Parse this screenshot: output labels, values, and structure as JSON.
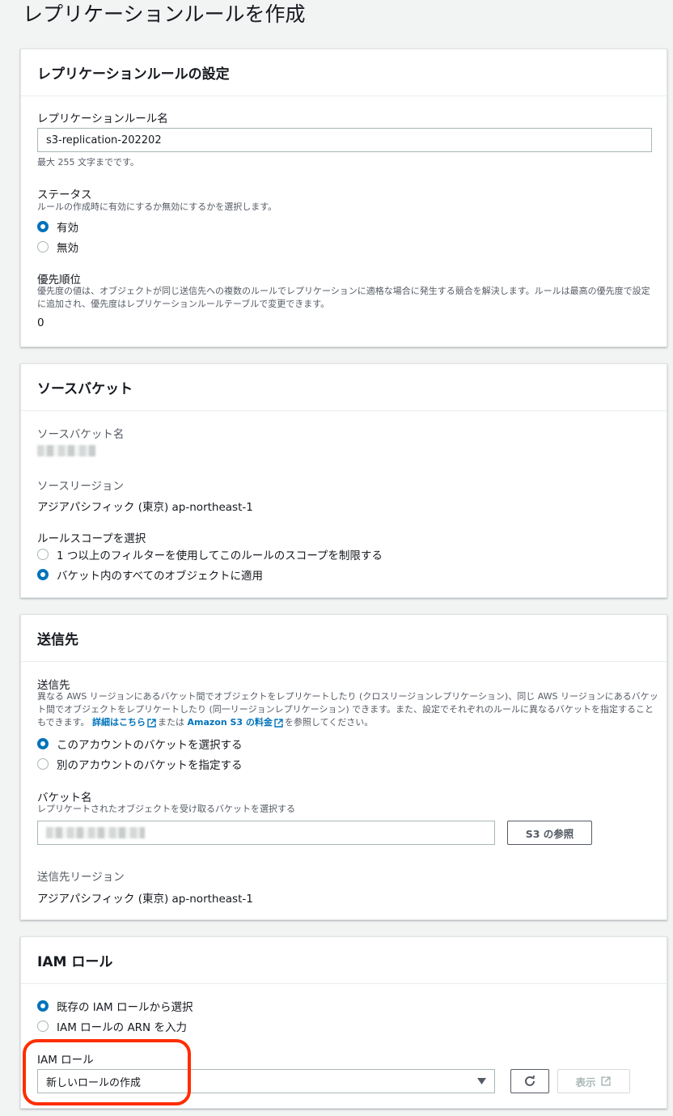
{
  "page": {
    "title": "レプリケーションルールを作成"
  },
  "rule_settings": {
    "header": "レプリケーションルールの設定",
    "name_label": "レプリケーションルール名",
    "name_value": "s3-replication-202202",
    "name_hint": "最大 255 文字までです。",
    "status_label": "ステータス",
    "status_desc": "ルールの作成時に有効にするか無効にするかを選択します。",
    "status_options": [
      "有効",
      "無効"
    ],
    "priority_label": "優先順位",
    "priority_desc": "優先度の値は、オブジェクトが同じ送信先への複数のルールでレプリケーションに適格な場合に発生する競合を解決します。ルールは最高の優先度で設定に追加され、優先度はレプリケーションルールテーブルで変更できます。",
    "priority_value": "0"
  },
  "source_bucket": {
    "header": "ソースバケット",
    "name_label": "ソースバケット名",
    "region_label": "ソースリージョン",
    "region_value": "アジアパシフィック (東京) ap-northeast-1",
    "scope_label": "ルールスコープを選択",
    "scope_options": [
      "1 つ以上のフィルターを使用してこのルールのスコープを制限する",
      "バケット内のすべてのオブジェクトに適用"
    ]
  },
  "destination": {
    "header": "送信先",
    "label": "送信先",
    "desc_part1": "異なる AWS リージョンにあるバケット間でオブジェクトをレプリケートしたり (クロスリージョンレプリケーション)、同じ AWS リージョンにあるバケット間でオブジェクトをレプリケートしたり (同一リージョンレプリケーション) できます。また、設定でそれぞれのルールに異なるバケットを指定することもできます。",
    "link1": "詳細はこちら",
    "desc_part2": "または",
    "link2": "Amazon S3 の料金",
    "desc_part3": "を参照してください。",
    "options": [
      "このアカウントのバケットを選択する",
      "別のアカウントのバケットを指定する"
    ],
    "bucket_label": "バケット名",
    "bucket_desc": "レプリケートされたオブジェクトを受け取るバケットを選択する",
    "browse_button": "S3 の参照",
    "region_label": "送信先リージョン",
    "region_value": "アジアパシフィック (東京) ap-northeast-1"
  },
  "iam_role": {
    "header": "IAM ロール",
    "options": [
      "既存の IAM ロールから選択",
      "IAM ロールの ARN を入力"
    ],
    "role_label": "IAM ロール",
    "role_selected": "新しいロールの作成",
    "view_button": "表示"
  },
  "colors": {
    "accent": "#0073bb",
    "highlight": "#ff2d00"
  }
}
